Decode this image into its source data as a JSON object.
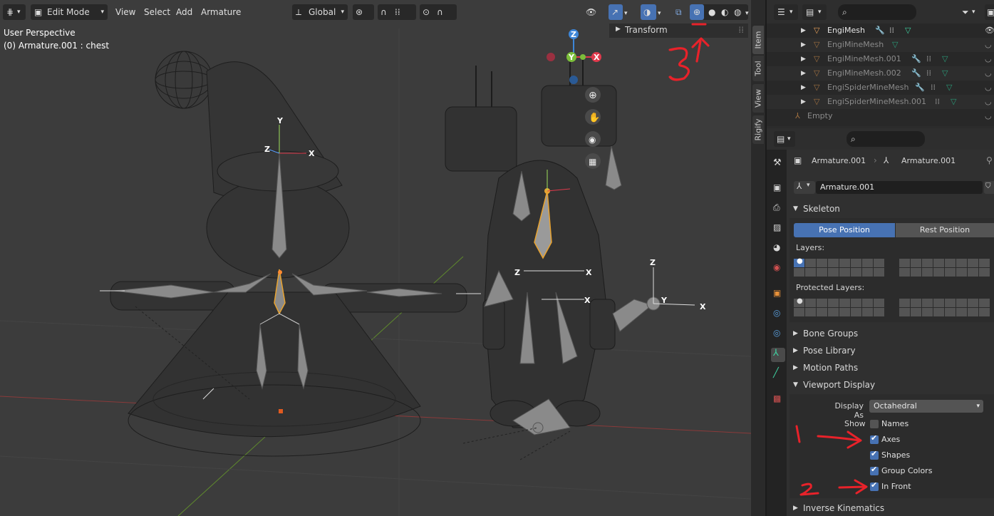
{
  "viewport": {
    "mode": "Edit Mode",
    "menus": [
      "View",
      "Select",
      "Add",
      "Armature"
    ],
    "transform_orientation": "Global",
    "info_line1": "User Perspective",
    "info_line2": "(0) Armature.001 : chest",
    "gizmo": {
      "z": "Z",
      "y": "Y",
      "x": "X"
    },
    "bone_axis_labels": {
      "x": "X",
      "y": "Y",
      "z": "Z"
    }
  },
  "npanel": {
    "tabs": [
      "Item",
      "Tool",
      "View",
      "Rigify"
    ],
    "transform_label": "Transform"
  },
  "outliner": {
    "rows": [
      {
        "name": "EngiMesh",
        "dim": false
      },
      {
        "name": "EngiMineMesh",
        "dim": true
      },
      {
        "name": "EngiMineMesh.001",
        "dim": true
      },
      {
        "name": "EngiMineMesh.002",
        "dim": true
      },
      {
        "name": "EngiSpiderMineMesh",
        "dim": true
      },
      {
        "name": "EngiSpiderMineMesh.001",
        "dim": true
      },
      {
        "name": "Empty",
        "dim": true
      }
    ]
  },
  "properties": {
    "breadcrumb_object": "Armature.001",
    "breadcrumb_data": "Armature.001",
    "datablock_name": "Armature.001",
    "skeleton": {
      "header": "Skeleton",
      "pose_position": "Pose Position",
      "rest_position": "Rest Position",
      "layers_label": "Layers:",
      "protected_layers_label": "Protected Layers:"
    },
    "collapsed_panels": [
      "Bone Groups",
      "Pose Library",
      "Motion Paths"
    ],
    "viewport_display": {
      "header": "Viewport Display",
      "display_as_label": "Display As",
      "display_as_value": "Octahedral",
      "show_label": "Show",
      "options": [
        {
          "label": "Names",
          "checked": false
        },
        {
          "label": "Axes",
          "checked": true
        },
        {
          "label": "Shapes",
          "checked": true
        },
        {
          "label": "Group Colors",
          "checked": true
        },
        {
          "label": "In Front",
          "checked": true
        }
      ]
    },
    "inverse_kinematics": "Inverse Kinematics"
  },
  "annotations": {
    "one": "1",
    "two": "2",
    "three": "3"
  },
  "colors": {
    "accent": "#4772b3",
    "annotation": "#e8222a",
    "axis_x": "#e03a4c",
    "axis_y": "#7bbe3a",
    "axis_z": "#3d86d8"
  }
}
